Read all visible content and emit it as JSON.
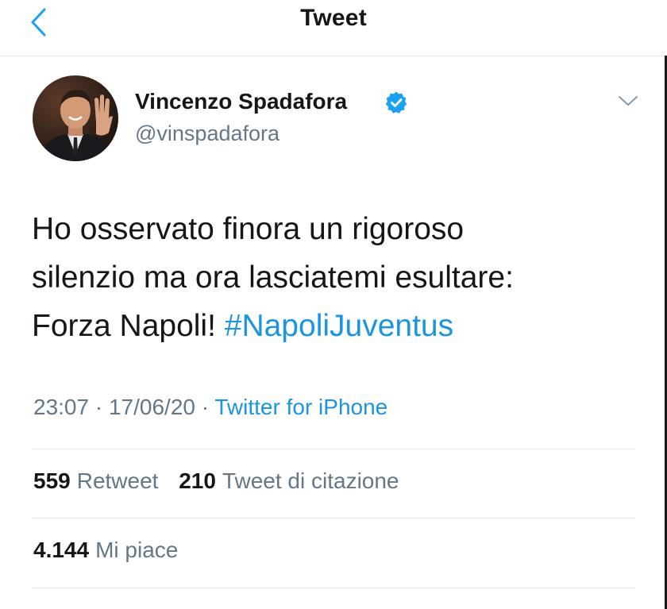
{
  "header": {
    "title": "Tweet"
  },
  "author": {
    "display_name": "Vincenzo Spadafora",
    "handle": "@vinspadafora",
    "verified": true
  },
  "tweet": {
    "text_lines": [
      "Ho osservato finora un rigoroso",
      "silenzio ma ora lasciatemi esultare:",
      "Forza Napoli! "
    ],
    "hashtag": "#NapoliJuventus",
    "time": "23:07",
    "separator": " · ",
    "date": "17/06/20",
    "source": "Twitter for iPhone"
  },
  "stats": {
    "retweets": {
      "count": "559",
      "label": "Retweet"
    },
    "quotes": {
      "count": "210",
      "label": "Tweet di citazione"
    },
    "likes": {
      "count": "4.144",
      "label": "Mi piace"
    }
  },
  "colors": {
    "link_blue": "#1b95e0",
    "text_primary": "#14171a",
    "text_secondary": "#657786",
    "divider": "#e1e8ed"
  },
  "icons": {
    "back": "chevron-left-icon",
    "verified": "verified-badge-icon",
    "menu": "chevron-down-icon"
  }
}
